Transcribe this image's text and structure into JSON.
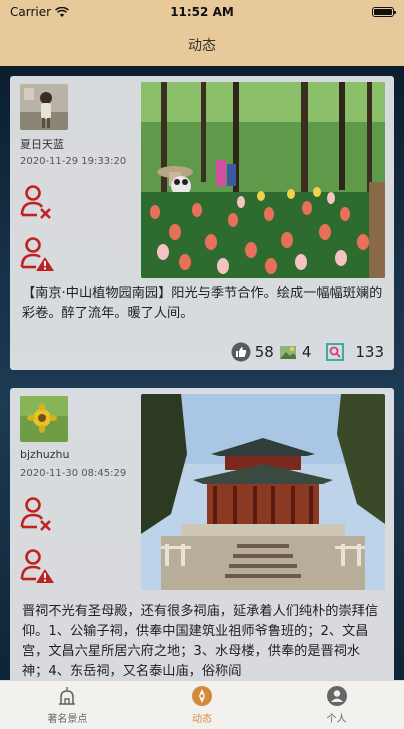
{
  "status_bar": {
    "carrier": "Carrier",
    "time": "11:52 AM"
  },
  "nav": {
    "title": "动态"
  },
  "posts": [
    {
      "username": "夏日天蓝",
      "timestamp": "2020-11-29 19:33:20",
      "text": "【南京·中山植物园南园】阳光与季节合作。绘成一幅幅斑斓的彩卷。醉了流年。暖了人间。",
      "likes": "58",
      "favorites": "4",
      "views": "133"
    },
    {
      "username": "bjzhuzhu",
      "timestamp": "2020-11-30 08:45:29",
      "text": "晋祠不光有圣母殿，还有很多祠庙，延承着人们纯朴的崇拜信仰。1、公输子祠，供奉中国建筑业祖师爷鲁班的；2、文昌宫，文昌六星所居六府之地；3、水母楼，供奉的是晋祠水神；4、东岳祠，又名泰山庙，俗称阎"
    }
  ],
  "tabbar": {
    "tabs": [
      {
        "label": "著名景点",
        "icon": "landmark-icon"
      },
      {
        "label": "动态",
        "icon": "compass-icon"
      },
      {
        "label": "个人",
        "icon": "person-icon"
      }
    ],
    "active_index": 1
  },
  "colors": {
    "accent": "#d48a3c",
    "nav_bg": "#e8c99a",
    "action_red": "#c0231f"
  }
}
